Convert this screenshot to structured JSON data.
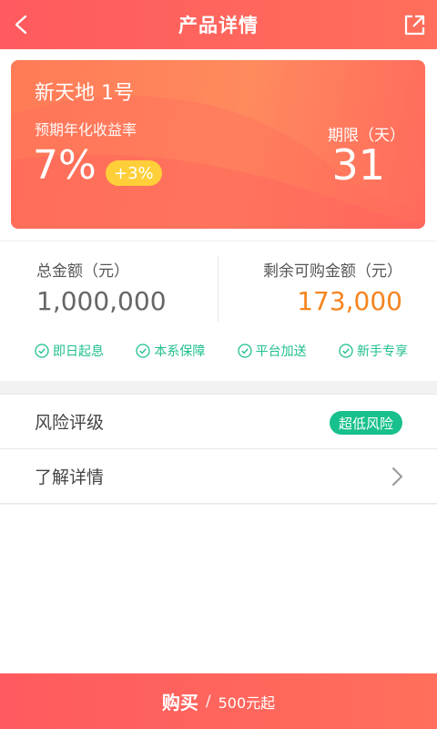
{
  "header": {
    "title": "产品详情",
    "back_icon": "chevron-left-icon",
    "share_icon": "share-icon"
  },
  "product": {
    "name": "新天地 1号",
    "yield_label": "预期年化收益率",
    "yield_value": "7%",
    "bonus": "+3%",
    "term_label": "期限（天）",
    "term_value": "31"
  },
  "amounts": {
    "total_label": "总金额（元）",
    "total_value": "1,000,000",
    "remaining_label": "剩余可购金额（元）",
    "remaining_value": "173,000"
  },
  "features": [
    {
      "label": "即日起息",
      "icon": "check-circle-icon"
    },
    {
      "label": "本系保障",
      "icon": "check-circle-icon"
    },
    {
      "label": "平台加送",
      "icon": "check-circle-icon"
    },
    {
      "label": "新手专享",
      "icon": "check-circle-icon"
    }
  ],
  "list": {
    "risk_label": "风险评级",
    "risk_value": "超低风险",
    "details_label": "了解详情"
  },
  "buy_bar": {
    "main": "购买",
    "separator": "/",
    "sub": "500元起"
  },
  "colors": {
    "primary": "#ff5a5f",
    "card": "#ff7b56",
    "accent_orange": "#f5841f",
    "green": "#17c08c",
    "badge_yellow": "#ffcf3a"
  }
}
